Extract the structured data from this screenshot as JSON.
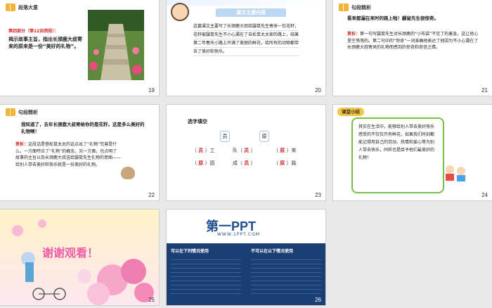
{
  "slides": [
    {
      "number": "19",
      "header": "段落大意",
      "title_line": "第四部分（第12自然段）：",
      "body": "揭示故事主旨，指出长颈鹿大叔寄来的原来是一份“美好的礼物”。"
    },
    {
      "number": "20",
      "title": "课文主要内容",
      "body": "这篇课文主要写了长颈鹿大叔给鼹鼠先生寄来一包花籽，花籽被鼹鼠先生不小心漏在了去松鼠太太家的路上，结果第二年春天小路上开满了美丽的鲜花，给所有的动物都带去了美好和快乐。"
    },
    {
      "number": "21",
      "header": "句段精析",
      "quote": "看来都漏在来时的路上啦！鼹鼠先生很惊奇。",
      "analysis_label": "赏析：",
      "analysis": "第一句写鼹鼠先生对长颈鹿的“小布袋”不见了的着急，这让他心里空荡荡的。第二句中的“惊奇”一词准确地表达了他因为不小心漏在了长颈鹿大叔寄来的礼物而感到的惊奇和奇怪之情。"
    },
    {
      "number": "22",
      "header": "句段精析",
      "quote": "我知道了，去年长颈鹿大叔寄给你的是花籽。这是多么美好的礼物啊！",
      "analysis_label": "赏析：",
      "analysis": "这段话是借松鼠太太的话点出了“礼物”究竟是什么，一方面呼应了“礼物”的概念，另一方面，也点明了故事的主旨以及长颈鹿大叔送给鼹鼠先生礼物的意图——给别人带去美好和快乐就是一份美好的礼物。"
    },
    {
      "number": "23",
      "title": "选字填空",
      "options": [
        "员",
        "原"
      ],
      "items": [
        {
          "answer": "员",
          "word": "工"
        },
        {
          "prefix": "队",
          "answer": "员",
          "word": ""
        },
        {
          "answer": "原",
          "word": "来"
        },
        {
          "answer": "原",
          "word": "因"
        },
        {
          "prefix": "成",
          "answer": "员",
          "word": ""
        },
        {
          "answer": "原",
          "word": "路"
        }
      ]
    },
    {
      "number": "24",
      "header": "课堂小结",
      "body": "其实在生活中，能够给别人带去美好快乐感受的不仅仅只有鲜花，如果我们时刻都能记得用自己的劳动、热情和爱心等为别人带去快乐，同样也是给予他们最美好的礼物！"
    },
    {
      "number": "25",
      "title": "谢谢观看！"
    },
    {
      "number": "26",
      "logo": "第一PPT",
      "url": "WWW.1PPT.COM",
      "left_heading": "可以在下列情况使用",
      "right_heading": "不可以在以下情况使用"
    }
  ],
  "colors": {
    "accent_green": "#4c9a2a",
    "accent_red": "#d42a2a",
    "slide_bg": "#ffffff",
    "page_bg": "#e9e9e9"
  }
}
